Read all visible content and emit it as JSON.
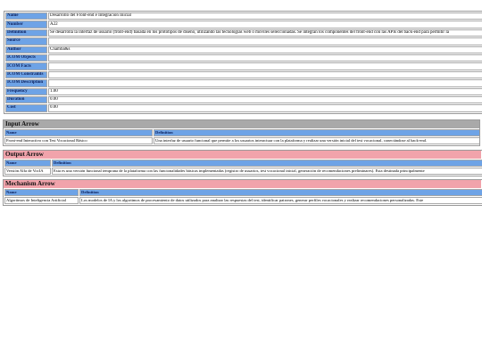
{
  "properties": [
    {
      "key": "Name",
      "value": "Desarrollo del Front-end e Integración Inicial"
    },
    {
      "key": "Number",
      "value": "A22"
    },
    {
      "key": "Definition",
      "value": "Se desarrolla la interfaz de usuario (front-end) basada en los prototipos de diseño, utilizando las tecnologías web o móviles seleccionadas. Se integran los componentes del front-end con las APIs del back-end para permitir la"
    },
    {
      "key": "Source",
      "value": ""
    },
    {
      "key": "Author",
      "value": "Chamba&s"
    },
    {
      "key": "ICOM Objects",
      "value": ""
    },
    {
      "key": "ICOM Facts",
      "value": ""
    },
    {
      "key": "ICOM Constraints",
      "value": ""
    },
    {
      "key": "ICOM Description",
      "value": ""
    },
    {
      "key": "Frequency",
      "value": "1.00"
    },
    {
      "key": "Duration",
      "value": "0.00"
    },
    {
      "key": "Cost",
      "value": "0.00"
    }
  ],
  "input_arrow": {
    "title": "Input Arrow",
    "col_name": "Name",
    "col_definition": "Definition",
    "rows": [
      {
        "name": "Front-end Interactivo con Test Vocacional Básico",
        "definition": "Una interfaz de usuario funcional que permite a los usuarios interactuar con la plataforma y realizar una versión inicial del test vocacional, conectándose al back-end."
      }
    ]
  },
  "output_arrow": {
    "title": "Output Arrow",
    "col_name": "Name",
    "col_definition": "Definition",
    "rows": [
      {
        "name": "Versión Alfa de VocIA",
        "definition": "Esta es una versión funcional temprana de la plataforma con las funcionalidades básicas implementadas (registro de usuarios, test vocacional inicial, generación de recomendaciones preliminares). Esta destinada principalmente"
      }
    ]
  },
  "mechanism_arrow": {
    "title": "Mechanism Arrow",
    "col_name": "Name",
    "col_definition": "Definition",
    "rows": [
      {
        "name": "Algoritmos de Inteligencia Artificial",
        "definition": "Los modelos de IA y los algoritmos de procesamiento de datos utilizados para analizar las respuestas del test, identificar patrones, generar perfiles vocacionales y realizar recomendaciones personalizadas. Este"
      }
    ]
  }
}
